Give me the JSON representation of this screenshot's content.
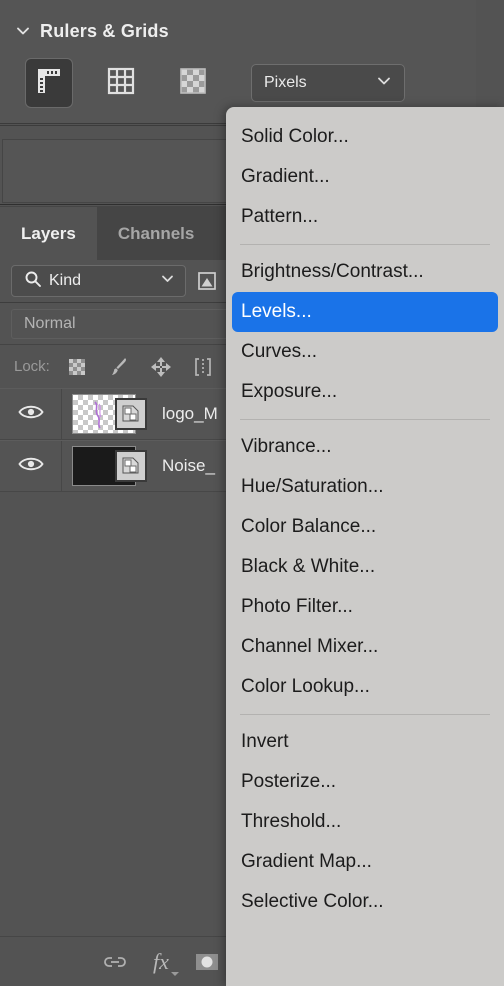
{
  "properties_panel": {
    "title": "Rulers & Grids",
    "disclosure_icon": "chevron-down-icon",
    "tools": [
      {
        "name": "rulers-toggle",
        "icon": "ruler-icon",
        "active": true
      },
      {
        "name": "grid-toggle",
        "icon": "grid-icon",
        "active": false
      },
      {
        "name": "transparency-grid-toggle",
        "icon": "checkerboard-icon",
        "active": false
      }
    ],
    "unit_select": {
      "value": "Pixels",
      "chevron_icon": "chevron-down-icon"
    }
  },
  "layers_panel": {
    "tabs": [
      {
        "label": "Layers",
        "active": true
      },
      {
        "label": "Channels",
        "active": false
      }
    ],
    "filter": {
      "search_icon": "magnifier-icon",
      "kind_value": "Kind",
      "chevron_icon": "chevron-down-icon",
      "filter_type_icon": "pixel-filter-icon"
    },
    "blend_mode": {
      "value": "Normal"
    },
    "lock": {
      "label": "Lock:",
      "icons": [
        "lock-transparent-pixels-icon",
        "lock-image-pixels-icon",
        "lock-position-icon",
        "lock-artboard-nesting-icon"
      ]
    },
    "layers": [
      {
        "visible": true,
        "visibility_icon": "eye-icon",
        "thumbnail": "transparent-checkerboard",
        "badge_icon": "smart-object-icon",
        "name": "logo_M"
      },
      {
        "visible": true,
        "visibility_icon": "eye-icon",
        "thumbnail": "dark-noise",
        "badge_icon": "smart-object-icon",
        "name": "Noise_"
      }
    ],
    "footer_icons": [
      "link-layers-icon",
      "add-layer-style-icon",
      "add-layer-mask-icon"
    ],
    "fx_label": "fx"
  },
  "context_menu": {
    "groups": [
      {
        "items": [
          {
            "label": "Solid Color...",
            "highlighted": false
          },
          {
            "label": "Gradient...",
            "highlighted": false
          },
          {
            "label": "Pattern...",
            "highlighted": false
          }
        ]
      },
      {
        "items": [
          {
            "label": "Brightness/Contrast...",
            "highlighted": false
          },
          {
            "label": "Levels...",
            "highlighted": true
          },
          {
            "label": "Curves...",
            "highlighted": false
          },
          {
            "label": "Exposure...",
            "highlighted": false
          }
        ]
      },
      {
        "items": [
          {
            "label": "Vibrance...",
            "highlighted": false
          },
          {
            "label": "Hue/Saturation...",
            "highlighted": false
          },
          {
            "label": "Color Balance...",
            "highlighted": false
          },
          {
            "label": "Black & White...",
            "highlighted": false
          },
          {
            "label": "Photo Filter...",
            "highlighted": false
          },
          {
            "label": "Channel Mixer...",
            "highlighted": false
          },
          {
            "label": "Color Lookup...",
            "highlighted": false
          }
        ]
      },
      {
        "items": [
          {
            "label": "Invert",
            "highlighted": false
          },
          {
            "label": "Posterize...",
            "highlighted": false
          },
          {
            "label": "Threshold...",
            "highlighted": false
          },
          {
            "label": "Gradient Map...",
            "highlighted": false
          },
          {
            "label": "Selective Color...",
            "highlighted": false
          }
        ]
      }
    ]
  },
  "colors": {
    "panel_background": "#535353",
    "menu_background": "#cccbc9",
    "highlight_blue": "#1a73e8",
    "text_light": "#ececec",
    "text_dark": "#1c1c1c"
  }
}
